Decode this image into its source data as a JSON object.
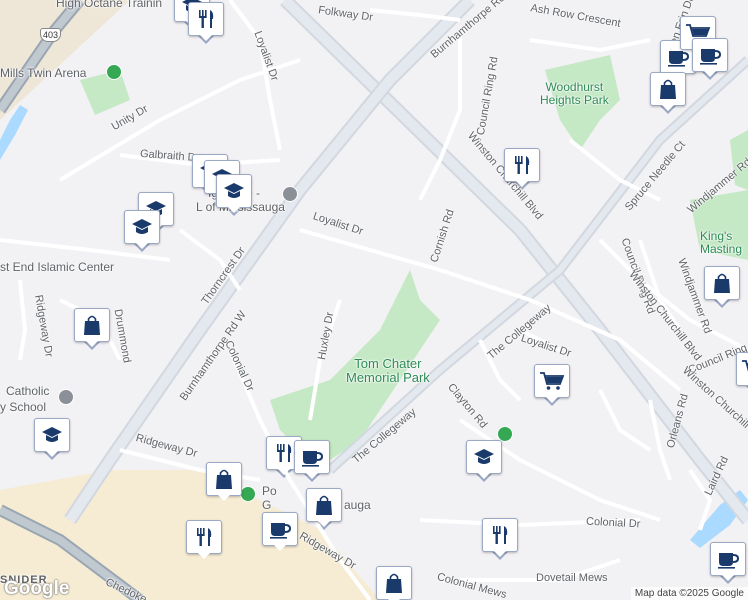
{
  "map": {
    "attribution": "Map data ©2025 Google",
    "logo": "Google",
    "highway_shield": "403"
  },
  "roads": [
    "Folkway Dr",
    "Burnhamthorpe Rd W",
    "Ash Row Crescent",
    "Council Ring Rd",
    "Glen Erin Dr",
    "Unity Dr",
    "Loyalist Dr",
    "Galbraith Dr",
    "Winston Churchill Blvd",
    "Cornish Rd",
    "Spruce Needle Ct",
    "Windjammer Rd",
    "Thorncrest Dr",
    "Loyalist Dr",
    "Ridgeway Dr",
    "Drummond",
    "Huxley Dr",
    "Colonial Dr",
    "The Collegeway",
    "Loyalist Dr",
    "Council Ring Rd",
    "Windjammer Rd",
    "Council Ring Rd",
    "Winston Churchill Blvd",
    "Winston Churchill Blvd",
    "Clayton Rd",
    "Orleans Rd",
    "Laird Rd",
    "Burnhamthorpe Rd W",
    "Ridgeway Dr",
    "The Collegeway",
    "Colonial Dr",
    "Ridgeway Dr",
    "Dovetail Mews",
    "Colonial Mews",
    "Chedoke",
    "SNIDER",
    "Ridgeway Dr"
  ],
  "places": {
    "training": "High Octane Trainin",
    "arena": "Mills Twin Arena",
    "church": "Iglesia                   o -",
    "church2": "L          of Mississauga",
    "islamic": "st End Islamic Center",
    "catholic": "Catholic",
    "school": "y School",
    "po_left": "Po",
    "po_right": "G",
    "po_tail": "auga",
    "woodhurst": [
      "Woodhurst",
      "Heights Park"
    ],
    "tom_chater": [
      "Tom Chater",
      "Memorial Park"
    ],
    "kings": [
      "King's",
      "Masting"
    ]
  },
  "markers": [
    {
      "type": "school-icon"
    },
    {
      "type": "restaurant-icon"
    },
    {
      "type": "cafe-icon"
    },
    {
      "type": "grocery-icon"
    },
    {
      "type": "school-icon"
    },
    {
      "type": "school-icon"
    },
    {
      "type": "school-icon"
    },
    {
      "type": "shopping-icon"
    },
    {
      "type": "restaurant-icon"
    },
    {
      "type": "shopping-icon"
    },
    {
      "type": "cafe-icon"
    },
    {
      "type": "shopping-icon"
    },
    {
      "type": "school-icon"
    },
    {
      "type": "grocery-icon"
    },
    {
      "type": "school-icon"
    },
    {
      "type": "restaurant-icon"
    },
    {
      "type": "shopping-icon"
    },
    {
      "type": "school-icon"
    },
    {
      "type": "restaurant-icon"
    },
    {
      "type": "cafe-icon"
    },
    {
      "type": "shopping-icon"
    },
    {
      "type": "restaurant-icon"
    },
    {
      "type": "shopping-icon"
    },
    {
      "type": "cafe-icon"
    },
    {
      "type": "grocery-icon"
    },
    {
      "type": "school-icon"
    },
    {
      "type": "cafe-icon"
    }
  ]
}
